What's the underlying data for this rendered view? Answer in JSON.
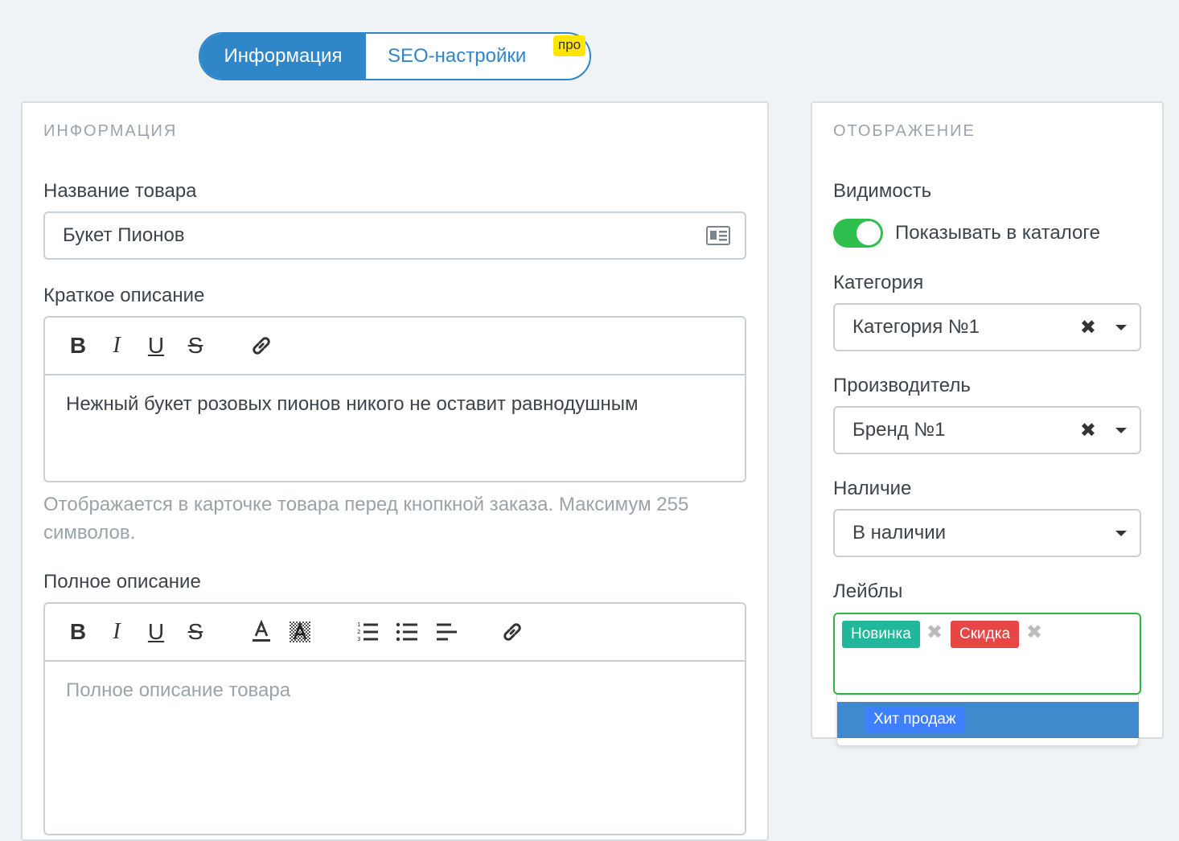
{
  "tabs": {
    "info": "Информация",
    "seo": "SEO-настройки",
    "seo_badge": "про"
  },
  "info_card": {
    "title": "ИНФОРМАЦИЯ",
    "product_name_label": "Название товара",
    "product_name_value": "Букет Пионов",
    "short_desc_label": "Краткое описание",
    "short_desc_value": "Нежный букет розовых пионов никого не оставит равнодушным",
    "short_desc_hint": "Отображается в карточке товара перед кнопкной заказа. Максимум 255 символов.",
    "full_desc_label": "Полное описание",
    "full_desc_placeholder": "Полное описание товара",
    "toolbar": {
      "bold": "B",
      "italic": "I",
      "underline": "U",
      "strike": "S"
    }
  },
  "display_card": {
    "title": "ОТОБРАЖЕНИЕ",
    "visibility_label": "Видимость",
    "visibility_toggle_label": "Показывать в каталоге",
    "visibility_on": true,
    "category_label": "Категория",
    "category_value": "Категория №1",
    "manufacturer_label": "Производитель",
    "manufacturer_value": "Бренд №1",
    "availability_label": "Наличие",
    "availability_value": "В наличии",
    "labels_label": "Лейблы",
    "selected_labels": [
      {
        "text": "Новинка",
        "color": "#1fb89a"
      },
      {
        "text": "Скидка",
        "color": "#e84545"
      }
    ],
    "dropdown_option": {
      "text": "Хит продаж",
      "color": "#3d7fff"
    }
  },
  "colors": {
    "accent": "#2f86c8",
    "toggle_on": "#2fbf4d",
    "focus_border": "#34b44a"
  }
}
